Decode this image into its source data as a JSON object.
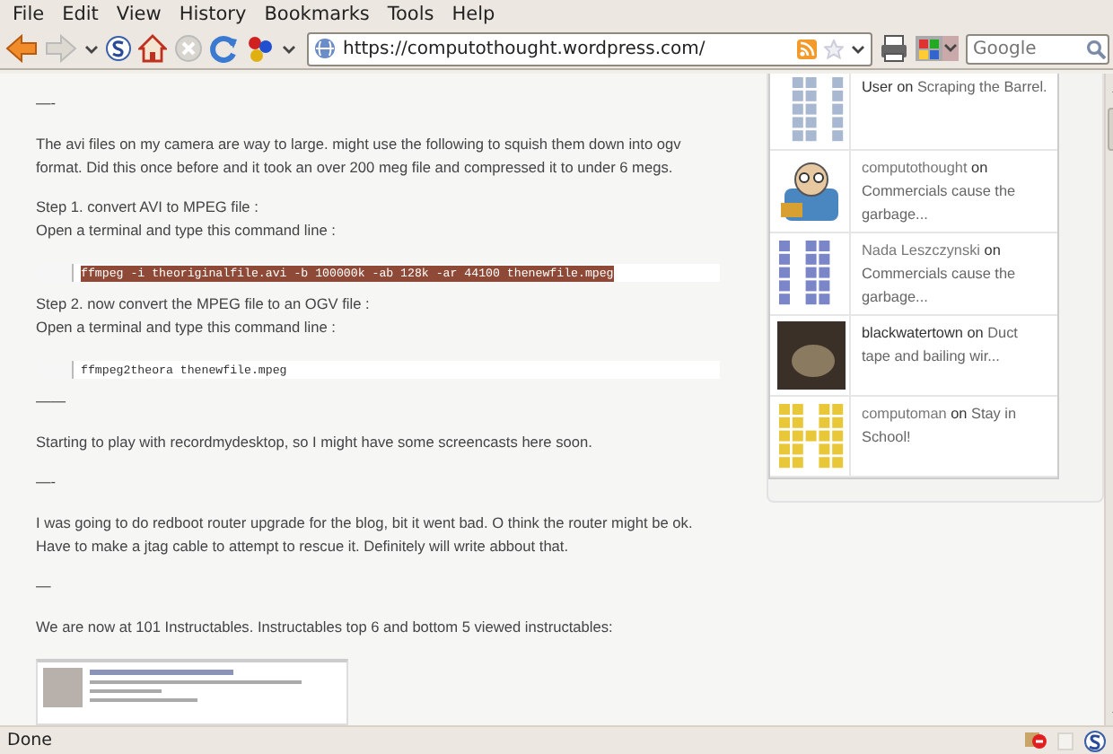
{
  "menu": [
    "File",
    "Edit",
    "View",
    "History",
    "Bookmarks",
    "Tools",
    "Help"
  ],
  "toolbar": {
    "url": "https://computothought.wordpress.com/",
    "search": {
      "placeholder": "Google"
    }
  },
  "posts": [
    {
      "kind": "separator",
      "text": "—-"
    },
    {
      "kind": "paragraph",
      "lines": [
        "The avi files on my camera are way to large. might use the following to squish them down into ogv",
        "format. Did this once before and it took an over 200 meg file and compressed it to under 6 megs."
      ]
    },
    {
      "kind": "paragraph",
      "lines": [
        "Step 1. convert AVI to MPEG file :",
        "Open a terminal and type this command line :"
      ]
    },
    {
      "kind": "code",
      "text": "ffmpeg -i theoriginalfile.avi -b 100000k -ab 128k -ar 44100 thenewfile.mpeg",
      "selected": true
    },
    {
      "kind": "paragraph",
      "lines": [
        "Step 2. now convert the MPEG file to an OGV file :",
        "Open a terminal and type this command line :"
      ]
    },
    {
      "kind": "code",
      "text": "ffmpeg2theora thenewfile.mpeg",
      "selected": false
    },
    {
      "kind": "separator",
      "text": "——"
    },
    {
      "kind": "paragraph",
      "lines": [
        "Starting to play with recordmydesktop, so I might have some screencasts here soon."
      ]
    },
    {
      "kind": "separator",
      "text": "—-"
    },
    {
      "kind": "paragraph",
      "lines": [
        "I was going to do redboot router upgrade for the blog, bit it went bad. O think the router might be ok.",
        "Have to make a jtag cable to attempt to rescue it. Definitely will write abbout that."
      ]
    },
    {
      "kind": "separator",
      "text": "—"
    },
    {
      "kind": "paragraph",
      "lines": [
        "We are now at 101 Instructables. Instructables top 6 and bottom 5 viewed instructables:"
      ]
    },
    {
      "kind": "screenshot"
    }
  ],
  "recent_comments": [
    {
      "kind": "identicon",
      "author": "User",
      "on": "on",
      "post": "Scraping the Barrel."
    },
    {
      "kind": "cartoon",
      "author": "computothought",
      "on": "on",
      "post": "Commercials cause the garbage..."
    },
    {
      "kind": "identicon",
      "author": "Nada Leszczynski",
      "on": "on",
      "post": "Commercials cause the garbage..."
    },
    {
      "kind": "photo",
      "author": "blackwatertown",
      "on": "on",
      "post": "Duct tape and bailing wir..."
    },
    {
      "kind": "identicon",
      "author": "computoman",
      "on": "on",
      "post": "Stay in School!"
    }
  ],
  "status_bar": {
    "text": "Done"
  }
}
